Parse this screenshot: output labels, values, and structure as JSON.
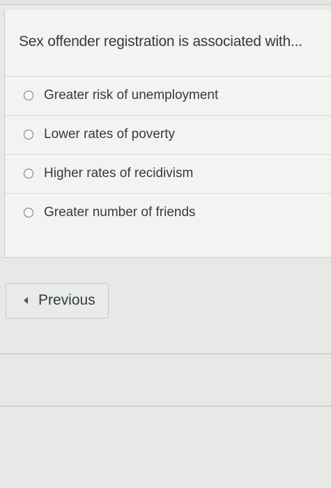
{
  "question": {
    "text": "Sex offender registration is associated with..."
  },
  "answers": [
    {
      "label": "Greater risk of unemployment"
    },
    {
      "label": "Lower rates of poverty"
    },
    {
      "label": "Higher rates of recidivism"
    },
    {
      "label": "Greater number of friends"
    }
  ],
  "navigation": {
    "previous_label": "Previous",
    "previous_icon": "caret-left-icon"
  }
}
